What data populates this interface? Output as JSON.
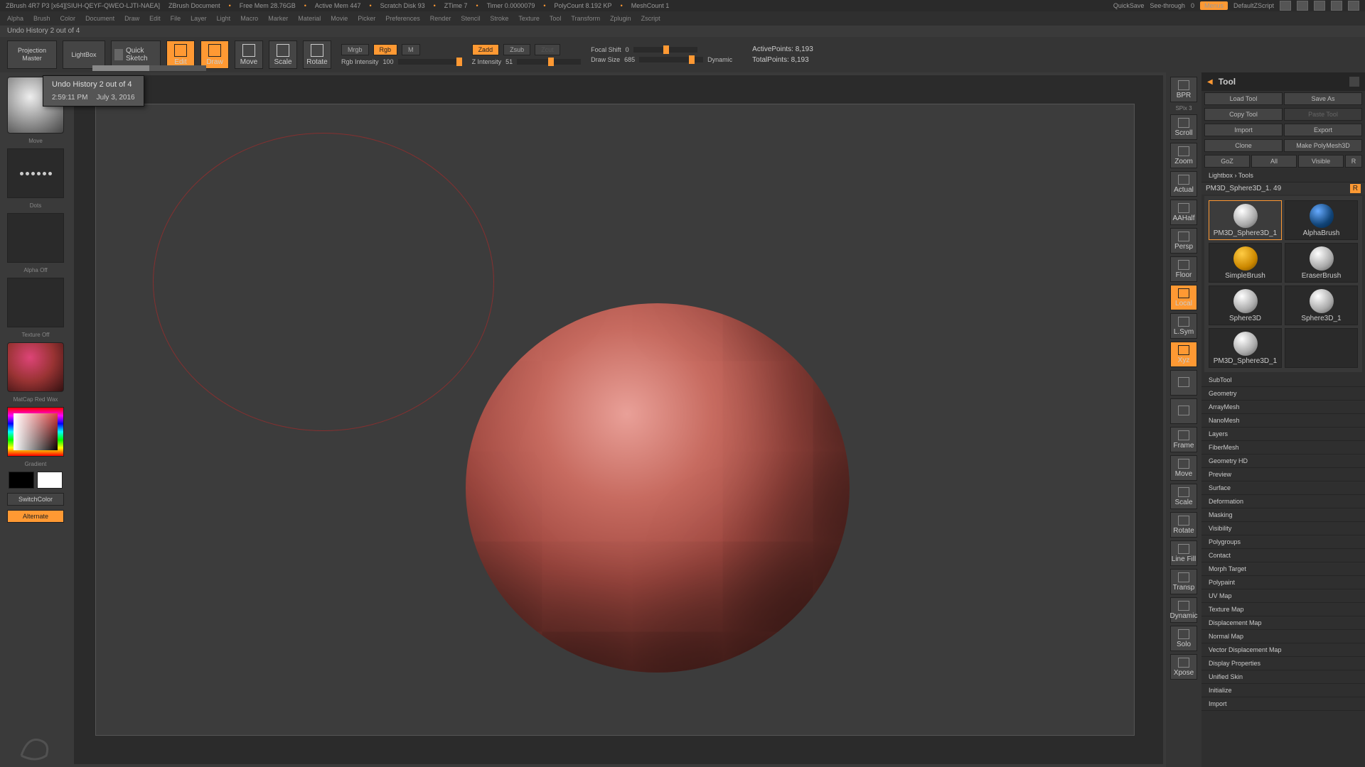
{
  "topbar": {
    "app": "ZBrush 4R7 P3 [x64][SIUH-QEYF-QWEO-LJTI-NAEA]",
    "doc": "ZBrush Document",
    "freemem": "Free Mem 28.76GB",
    "activemem": "Active Mem 447",
    "scratch": "Scratch Disk 93",
    "ztime": "ZTime 7",
    "timer": "Timer 0.0000079",
    "polycount": "PolyCount 8.192 KP",
    "meshcount": "MeshCount 1",
    "quicksave": "QuickSave",
    "seethrough": "See-through",
    "seethrough_val": "0",
    "menus": "Menus",
    "script": "DefaultZScript"
  },
  "menus": [
    "Alpha",
    "Brush",
    "Color",
    "Document",
    "Draw",
    "Edit",
    "File",
    "Layer",
    "Light",
    "Macro",
    "Marker",
    "Material",
    "Movie",
    "Picker",
    "Preferences",
    "Render",
    "Stencil",
    "Stroke",
    "Texture",
    "Tool",
    "Transform",
    "Zplugin",
    "Zscript"
  ],
  "status": "Undo History 2 out of 4",
  "toolbar": {
    "projection": "Projection\nMaster",
    "lightbox": "LightBox",
    "quicksketch": "Quick\nSketch",
    "modes": [
      "Edit",
      "Draw",
      "Move",
      "Scale",
      "Rotate"
    ],
    "mrgb": "Mrgb",
    "rgb": "Rgb",
    "m": "M",
    "rgb_intensity_lbl": "Rgb Intensity",
    "rgb_intensity_val": "100",
    "zadd": "Zadd",
    "zsub": "Zsub",
    "zcut": "Zcut",
    "z_intensity_lbl": "Z Intensity",
    "z_intensity_val": "51",
    "focal_lbl": "Focal Shift",
    "focal_val": "0",
    "draw_lbl": "Draw Size",
    "draw_val": "685",
    "dynamic": "Dynamic",
    "active_pts": "ActivePoints: 8,193",
    "total_pts": "TotalPoints: 8,193"
  },
  "tooltip": {
    "line1": "Undo History 2 out of 4",
    "time": "2:59:11 PM",
    "date": "July 3, 2016"
  },
  "left": {
    "brush": "Move",
    "stroke": "Dots",
    "alpha": "Alpha Off",
    "texture": "Texture Off",
    "material": "MatCap Red Wax",
    "gradient": "Gradient",
    "switch": "SwitchColor",
    "alternate": "Alternate"
  },
  "rightstrip": {
    "spix": "SPix 3",
    "items": [
      "BPR",
      "Scroll",
      "Zoom",
      "Actual",
      "AAHalf",
      "Persp",
      "Floor",
      "Local",
      "L.Sym",
      "Xyz",
      "",
      "",
      "Frame",
      "Move",
      "Scale",
      "Rotate",
      "Line Fill",
      "Transp",
      "Dynamic",
      "Solo",
      "Xpose"
    ]
  },
  "tool": {
    "title": "Tool",
    "load": "Load Tool",
    "save": "Save As",
    "copy": "Copy Tool",
    "paste": "Paste Tool",
    "import": "Import",
    "export": "Export",
    "clone": "Clone",
    "makepoly": "Make PolyMesh3D",
    "goz": "GoZ",
    "all": "All",
    "visible": "Visible",
    "r": "R",
    "lightbox_tools": "Lightbox › Tools",
    "current": "PM3D_Sphere3D_1. 49",
    "current_r": "R",
    "grid": [
      "PM3D_Sphere3D_1",
      "AlphaBrush",
      "SimpleBrush",
      "EraserBrush",
      "Sphere3D",
      "Sphere3D_1",
      "PM3D_Sphere3D_1",
      ""
    ],
    "sections": [
      "SubTool",
      "Geometry",
      "ArrayMesh",
      "NanoMesh",
      "Layers",
      "FiberMesh",
      "Geometry HD",
      "Preview",
      "Surface",
      "Deformation",
      "Masking",
      "Visibility",
      "Polygroups",
      "Contact",
      "Morph Target",
      "Polypaint",
      "UV Map",
      "Texture Map",
      "Displacement Map",
      "Normal Map",
      "Vector Displacement Map",
      "Display Properties",
      "Unified Skin",
      "Initialize",
      "Import"
    ]
  }
}
